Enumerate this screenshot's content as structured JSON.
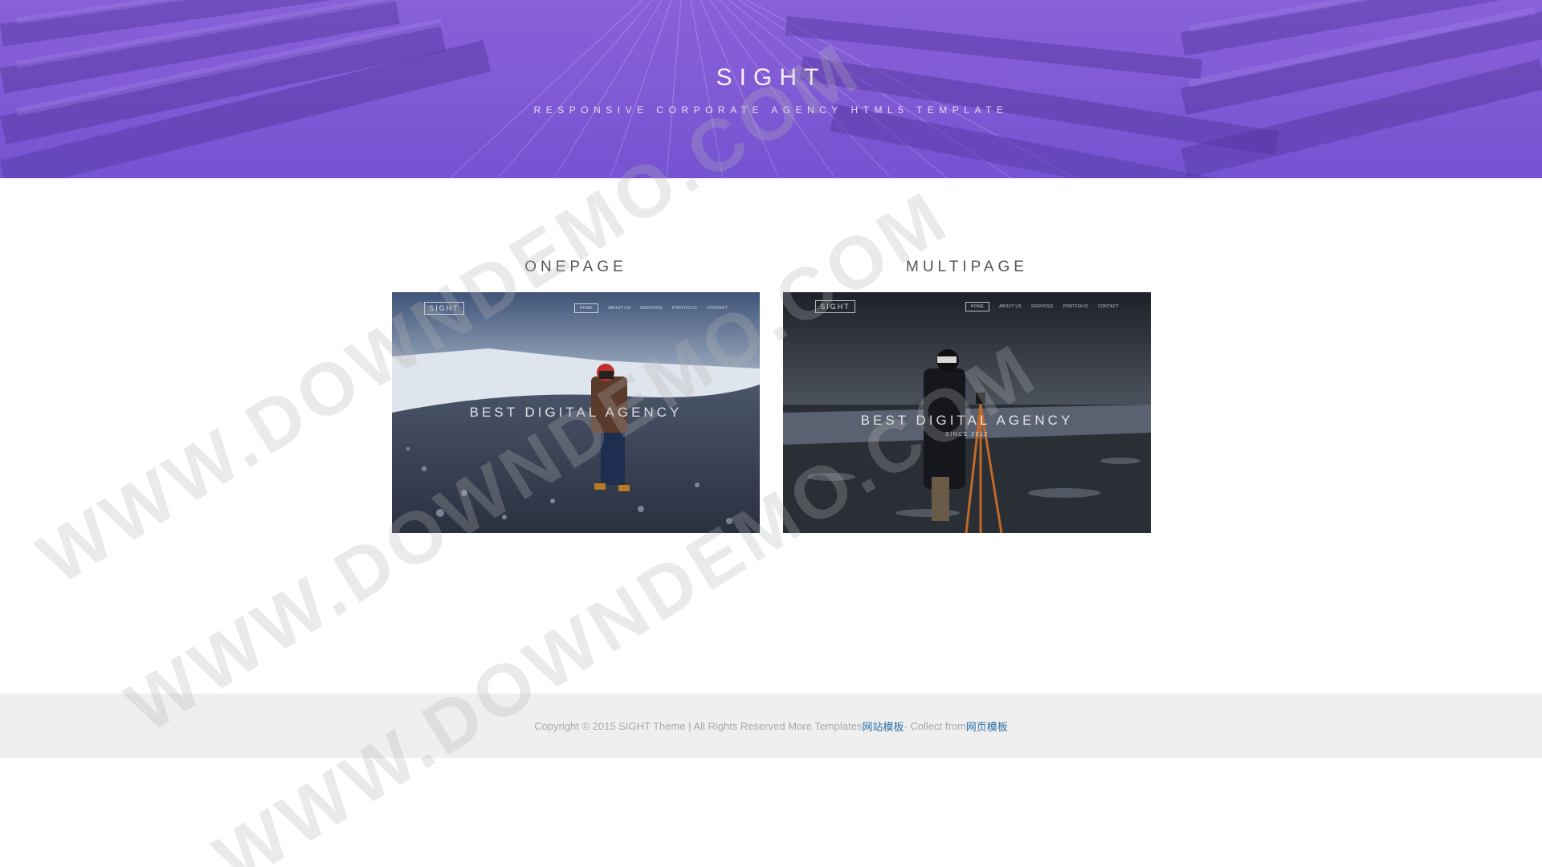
{
  "hero": {
    "title": "SIGHT",
    "subtitle": "RESPONSIVE CORPORATE AGENCY HTML5 TEMPLATE"
  },
  "demos": [
    {
      "label": "ONEPAGE",
      "thumb": {
        "logo": "SIGHT",
        "nav": [
          "HOME",
          "ABOUT US",
          "SERVICES",
          "PORTFOLIO",
          "CONTACT"
        ],
        "headline": "BEST DIGITAL AGENCY",
        "since": ""
      }
    },
    {
      "label": "MULTIPAGE",
      "thumb": {
        "logo": "SIGHT",
        "nav": [
          "HOME",
          "ABOUT US",
          "SERVICES",
          "PORTFOLIO",
          "CONTACT"
        ],
        "headline": "BEST DIGITAL AGENCY",
        "since": "SINCE 2012"
      }
    }
  ],
  "footer": {
    "copyright": "Copyright © 2015 SIGHT Theme | All Rights Reserved More Templates ",
    "link1": "网站模板",
    "middle": " - Collect from ",
    "link2": "网页模板"
  },
  "watermark": "WWW.DOWNDEMO.COM",
  "colors": {
    "hero_purple": "#8657d4",
    "footer_bg": "#efefef",
    "footer_link": "#2a6ea8"
  }
}
